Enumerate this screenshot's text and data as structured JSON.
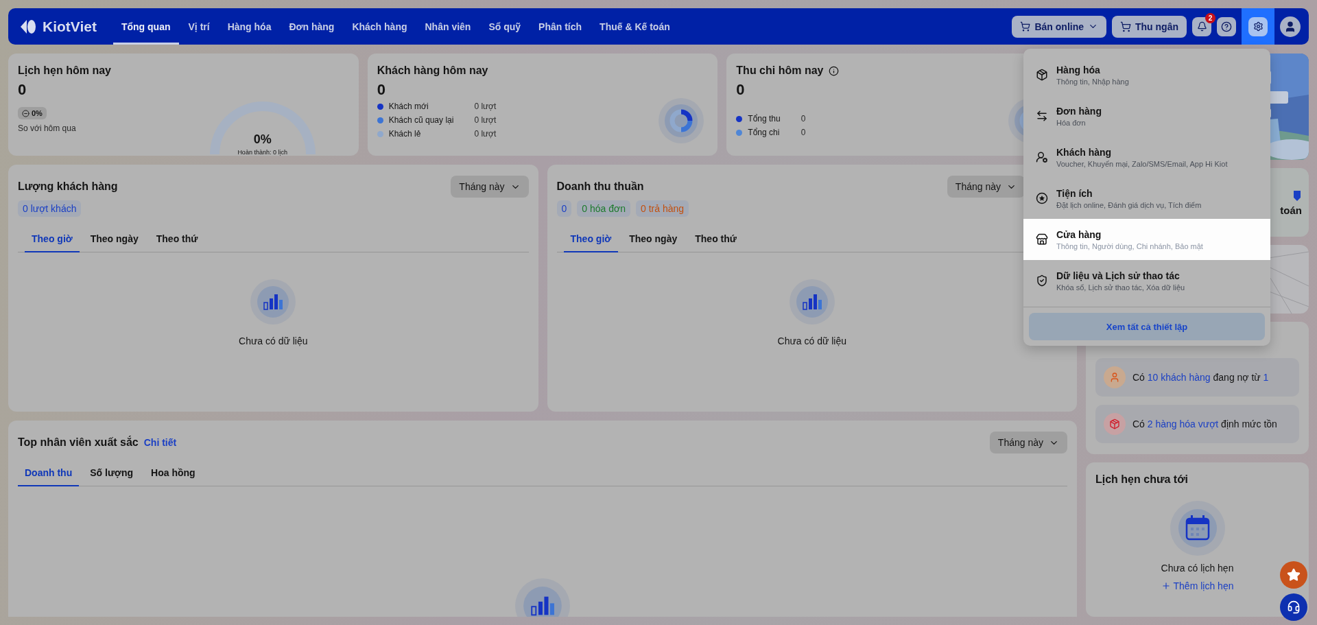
{
  "header": {
    "logo": "KiotViet",
    "nav": [
      {
        "label": "Tổng quan",
        "selected": true
      },
      {
        "label": "Vị trí",
        "selected": false
      },
      {
        "label": "Hàng hóa",
        "selected": false
      },
      {
        "label": "Đơn hàng",
        "selected": false
      },
      {
        "label": "Khách hàng",
        "selected": false
      },
      {
        "label": "Nhân viên",
        "selected": false
      },
      {
        "label": "Sổ quỹ",
        "selected": false
      },
      {
        "label": "Phân tích",
        "selected": false
      },
      {
        "label": "Thuế & Kế toán",
        "selected": false
      }
    ],
    "actions": [
      {
        "kind": "dropdown",
        "label": "Bán online"
      },
      {
        "kind": "cart",
        "label": "Thu ngân"
      },
      {
        "kind": "bell",
        "badge": "2"
      },
      {
        "kind": "help"
      },
      {
        "kind": "settings",
        "open": true
      },
      {
        "kind": "avatar"
      }
    ]
  },
  "summary_cards": [
    {
      "kind": "appointments",
      "title": "Lịch hẹn hôm nay",
      "value": "0",
      "change": "0%",
      "note": "So với hôm qua",
      "gauge_value": "0%",
      "gauge_caption": "Hoàn thành: 0 lịch"
    },
    {
      "kind": "customers",
      "title": "Khách hàng hôm nay",
      "value": "0",
      "legend": [
        {
          "label": "Khách mới",
          "value": "0 lượt",
          "color": "#1533c4"
        },
        {
          "label": "Khách cũ quay lại",
          "value": "0 lượt",
          "color": "#3c74d4"
        },
        {
          "label": "Khách lẻ",
          "value": "0 lượt",
          "color": "#8fa8cc"
        }
      ]
    },
    {
      "kind": "cashflow",
      "title": "Thu chi hôm nay",
      "info": true,
      "value": "0",
      "legend": [
        {
          "label": "Tổng thu",
          "value": "0",
          "color": "#1533c4"
        },
        {
          "label": "Tổng chi",
          "value": "0",
          "color": "#4f86d6"
        }
      ]
    }
  ],
  "panels": [
    {
      "title": "Lượng khách hàng",
      "period": "Tháng này",
      "chips": [
        {
          "label": "0 lượt khách",
          "color": "#1a3fc4"
        }
      ],
      "tabs": [
        {
          "label": "Theo giờ",
          "selected": true
        },
        {
          "label": "Theo ngày",
          "selected": false
        },
        {
          "label": "Theo thứ",
          "selected": false
        }
      ],
      "empty": "Chưa có dữ liệu"
    },
    {
      "title": "Doanh thu thuần",
      "period": "Tháng này",
      "chips": [
        {
          "label": "0",
          "color": "#1a3fc4"
        },
        {
          "label": "0 hóa đơn",
          "color": "#1c7a2c"
        },
        {
          "label": "0 trả hàng",
          "color": "#c2500f"
        }
      ],
      "tabs": [
        {
          "label": "Theo giờ",
          "selected": true
        },
        {
          "label": "Theo ngày",
          "selected": false
        },
        {
          "label": "Theo thứ",
          "selected": false
        }
      ],
      "empty": "Chưa có dữ liệu"
    }
  ],
  "top_staff": {
    "title": "Top nhân viên xuất sắc",
    "link": "Chi tiết",
    "period": "Tháng này",
    "tabs": [
      {
        "label": "Doanh thu",
        "selected": true
      },
      {
        "label": "Số lượng",
        "selected": false
      },
      {
        "label": "Hoa hồng",
        "selected": false
      }
    ]
  },
  "side": {
    "feature_card": {
      "text": "toán"
    },
    "alerts": [
      {
        "kind": "customer",
        "parts": [
          {
            "text": "Có",
            "link": false
          },
          {
            "text": "10 khách hàng",
            "link": true
          },
          {
            "text": "đang nợ từ",
            "link": false
          },
          {
            "text": "1",
            "link": true
          }
        ]
      },
      {
        "kind": "stock",
        "parts": [
          {
            "text": "Có",
            "link": false
          },
          {
            "text": "2 hàng hóa vượt",
            "link": true
          },
          {
            "text": "định mức tồn",
            "link": false
          }
        ]
      }
    ],
    "appointments": {
      "title": "Lịch hẹn chưa tới",
      "empty": "Chưa có lịch hẹn",
      "add": "Thêm lịch hẹn"
    }
  },
  "settings_menu": {
    "items": [
      {
        "title": "Hàng hóa",
        "subtitle": "Thông tin, Nhập hàng",
        "selected": false
      },
      {
        "title": "Đơn hàng",
        "subtitle": "Hóa đơn",
        "selected": false
      },
      {
        "title": "Khách hàng",
        "subtitle": "Voucher, Khuyến mại, Zalo/SMS/Email, App Hi Kiot",
        "selected": false
      },
      {
        "title": "Tiện ích",
        "subtitle": "Đặt lịch online, Đánh giá dịch vụ, Tích điểm",
        "selected": false
      },
      {
        "title": "Cửa hàng",
        "subtitle": "Thông tin, Người dùng, Chi nhánh, Bảo mật",
        "selected": true
      },
      {
        "title": "Dữ liệu và Lịch sử thao tác",
        "subtitle": "Khóa sổ, Lịch sử thao tác, Xóa dữ liệu",
        "selected": false
      }
    ],
    "footer": "Xem tất cả thiết lập"
  }
}
